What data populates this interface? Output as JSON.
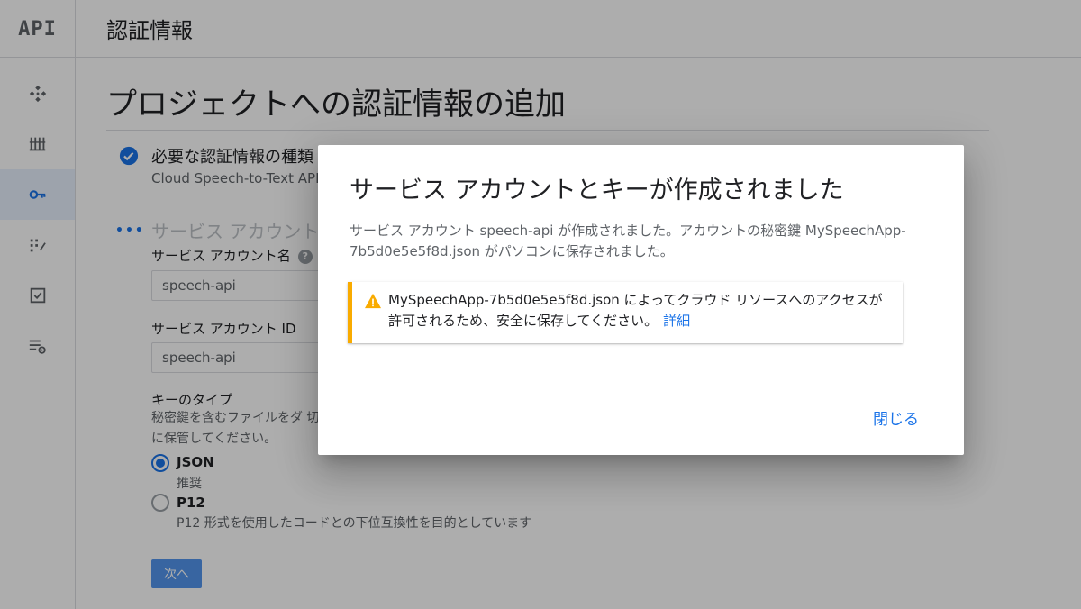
{
  "header": {
    "logo": "API",
    "title": "認証情報"
  },
  "sidebar": {
    "items": [
      {
        "icon": "dashboard-icon"
      },
      {
        "icon": "library-icon"
      },
      {
        "icon": "key-icon",
        "active": true
      },
      {
        "icon": "consent-screen-icon"
      },
      {
        "icon": "checkbox-icon"
      },
      {
        "icon": "settings-list-icon"
      }
    ]
  },
  "page": {
    "title": "プロジェクトへの認証情報の追加",
    "step1": {
      "title": "必要な認証情報の種類",
      "subtitle": "Cloud Speech-to-Text API"
    },
    "step2": {
      "title": "サービス アカウント"
    },
    "service_account_name_label": "サービス アカウント名",
    "service_account_name_value": "speech-api",
    "service_account_id_label": "サービス アカウント ID",
    "service_account_id_value": "speech-api",
    "key_type_label": "キーのタイプ",
    "key_type_desc": "秘密鍵を含むファイルをダ 切に保管してください。",
    "options": [
      {
        "label": "JSON",
        "sub": "推奨",
        "checked": true
      },
      {
        "label": "P12",
        "sub": "P12 形式を使用したコードとの下位互換性を目的としています",
        "checked": false
      }
    ],
    "next_button": "次へ"
  },
  "dialog": {
    "title": "サービス アカウントとキーが作成されました",
    "body": "サービス アカウント speech-api が作成されました。アカウントの秘密鍵 MySpeechApp-7b5d0e5e5f8d.json がパソコンに保存されました。",
    "warning_text": "MySpeechApp-7b5d0e5e5f8d.json によってクラウド リソースへのアクセスが許可されるため、安全に保存してください。",
    "warning_link": "詳細",
    "close_button": "閉じる"
  },
  "colors": {
    "accent": "#1a73e8",
    "warning": "#f9ab00",
    "scrim": "rgba(0,0,0,0.32)"
  }
}
